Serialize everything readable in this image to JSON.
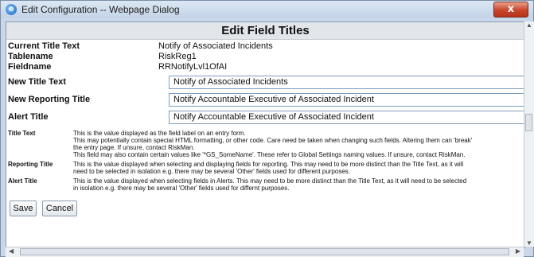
{
  "window": {
    "title": "Edit Configuration -- Webpage Dialog",
    "close_glyph": "x"
  },
  "header": {
    "title": "Edit Field Titles"
  },
  "info": {
    "current_title_label": "Current Title Text",
    "current_title_value": "Notify of Associated Incidents",
    "tablename_label": "Tablename",
    "tablename_value": "RiskReg1",
    "fieldname_label": "Fieldname",
    "fieldname_value": "RRNotifyLvl1OfAI"
  },
  "form": {
    "new_title_label": "New Title Text",
    "new_title_value": "Notify of Associated Incidents",
    "reporting_title_label": "New Reporting Title",
    "reporting_title_value": "Notify Accountable Executive of Associated Incident",
    "alert_title_label": "Alert Title",
    "alert_title_value": "Notify Accountable Executive of Associated Incident"
  },
  "help": {
    "title_text_label": "Title Text",
    "title_text_lines": [
      "This is the value displayed as the field label on an entry form.",
      "This may potentially contain special HTML formatting, or other code. Care need be taken when changing such fields. Altering them can 'break'",
      "the entry page. If unsure, contact RiskMan.",
      "This field may also contain certain values like '*GS_SomeName'. These refer to Global Settings naming values. If unsure, contact RiskMan."
    ],
    "reporting_title_label": "Reporting Title",
    "reporting_title_lines": [
      "This is the value displayed when selecting and displaying fields for reporting. This may need to be more distinct than the Title Text, as it will",
      "need to be selected in isolation e.g. there may be several 'Other' fields used for different purposes."
    ],
    "alert_title_label": "Alert Title",
    "alert_title_lines": [
      "This is the value displayed when selecting fields in Alerts. This may need to be more distinct than the Title Text, as it will need to be selected",
      "in isolation e.g. there may be several 'Other' fields used for differnt purposes."
    ]
  },
  "buttons": {
    "save": "Save",
    "cancel": "Cancel"
  },
  "icons": {
    "app": "ie-logo-icon",
    "close": "close-icon",
    "scroll_up": "scroll-up-arrow-icon",
    "scroll_down": "scroll-down-arrow-icon",
    "scroll_left": "scroll-left-arrow-icon",
    "scroll_right": "scroll-right-arrow-icon"
  },
  "colors": {
    "titlebar": "#c9d7e8",
    "close_button": "#c7452b",
    "header_bar": "#e2e6eb",
    "field_border": "#7f9db9"
  }
}
